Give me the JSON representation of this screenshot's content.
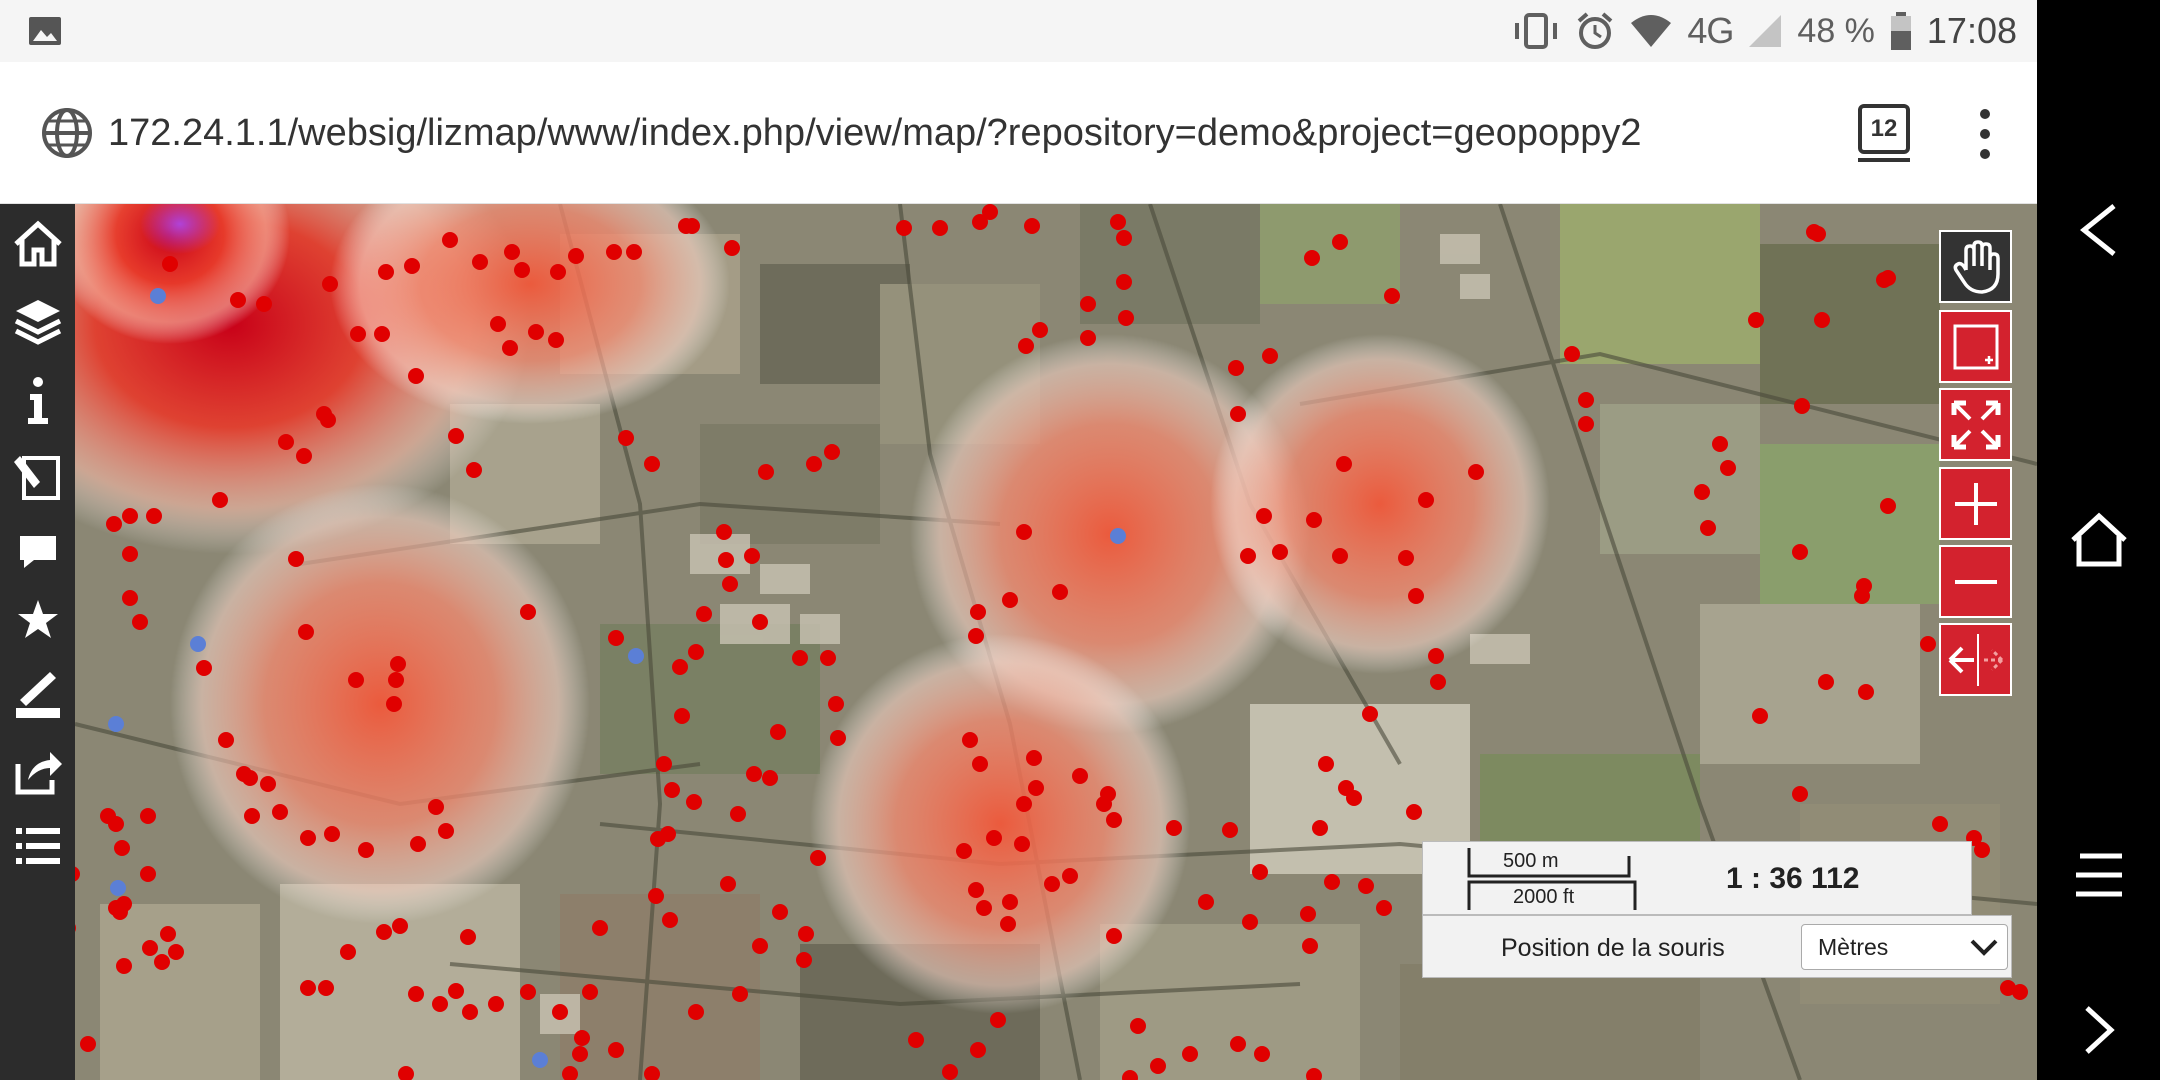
{
  "status_bar": {
    "network": "4G",
    "battery_percent": "48 %",
    "time": "17:08",
    "icons": [
      "gallery-icon",
      "vibrate-icon",
      "alarm-icon",
      "wifi-icon",
      "signal-icon",
      "battery-icon"
    ]
  },
  "browser": {
    "url": "172.24.1.1/websig/lizmap/www/index.php/view/map/?repository=demo&project=geopoppy2",
    "tab_count": "12"
  },
  "map": {
    "scale": {
      "metric_label": "500 m",
      "imperial_label": "2000 ft",
      "ratio": "1 : 36 112"
    },
    "mouse_position": {
      "label": "Position de la souris",
      "unit_selected": "Mètres"
    },
    "left_tools": [
      "home-icon",
      "layers-icon",
      "info-icon",
      "edit-icon",
      "comment-icon",
      "star-icon",
      "draw-measure-icon",
      "share-icon",
      "list-icon"
    ],
    "right_controls": [
      "pan-hand-icon",
      "zoom-box-icon",
      "zoom-extent-icon",
      "zoom-in-icon",
      "zoom-out-icon",
      "previous-view-icon"
    ],
    "colors": {
      "point_red": "#e00000",
      "point_blue": "#5b7fd6",
      "control_red": "#d3222e",
      "heat": "#f0583a"
    }
  },
  "nav_bar": {
    "buttons": [
      "back-icon",
      "home-icon",
      "menu-icon",
      "forward-icon"
    ]
  }
}
